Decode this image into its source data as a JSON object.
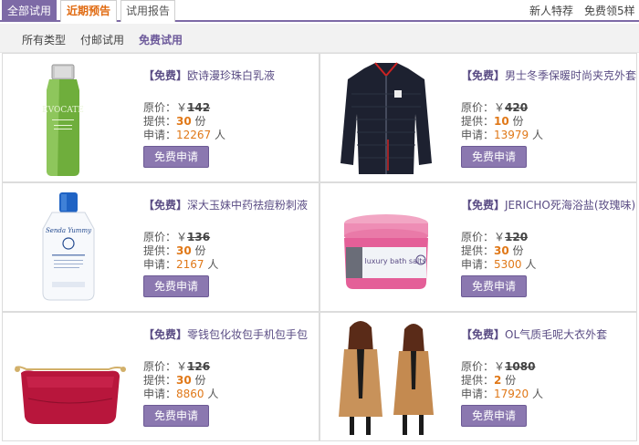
{
  "tabs": [
    {
      "label": "全部试用"
    },
    {
      "label": "近期预告"
    },
    {
      "label": "试用报告"
    }
  ],
  "top_links": {
    "newbie": "新人特荐",
    "free5": "免费领5样"
  },
  "filters": [
    "所有类型",
    "付邮试用",
    "免费试用"
  ],
  "labels": {
    "tag": "【免费】",
    "original_price": "原价：",
    "currency": "￥",
    "supply": "提供：",
    "supply_unit": " 份",
    "apply": "申请：",
    "apply_unit": " 人",
    "button": "免费申请"
  },
  "products": [
    {
      "name": "欧诗漫珍珠白乳液",
      "price": "142",
      "supply": "30",
      "applicants": "12267",
      "image": "lotion-bottle"
    },
    {
      "name": "男士冬季保暖时尚夹克外套",
      "price": "420",
      "supply": "10",
      "applicants": "13979",
      "image": "black-jacket"
    },
    {
      "name": "深大玉妹中药祛痘粉刺液",
      "price": "136",
      "supply": "30",
      "applicants": "2167",
      "image": "white-bottle"
    },
    {
      "name": "JERICHO死海浴盐(玫瑰味)",
      "price": "120",
      "supply": "30",
      "applicants": "5300",
      "image": "bath-salt-jar"
    },
    {
      "name": "零钱包化妆包手机包手包",
      "price": "126",
      "supply": "30",
      "applicants": "8860",
      "image": "cosmetic-bag"
    },
    {
      "name": "OL气质毛呢大衣外套",
      "price": "1080",
      "supply": "2",
      "applicants": "17920",
      "image": "camel-coat"
    }
  ],
  "image_text": {
    "lotion_brand": "EVOCATE",
    "bottle_brand": "Senda Yummy",
    "jar_label": "luxury bath salts"
  },
  "colors": {
    "accent": "#7d6aa6",
    "button": "#8b78b0",
    "highlight": "#e07818",
    "title": "#5a4c84"
  }
}
